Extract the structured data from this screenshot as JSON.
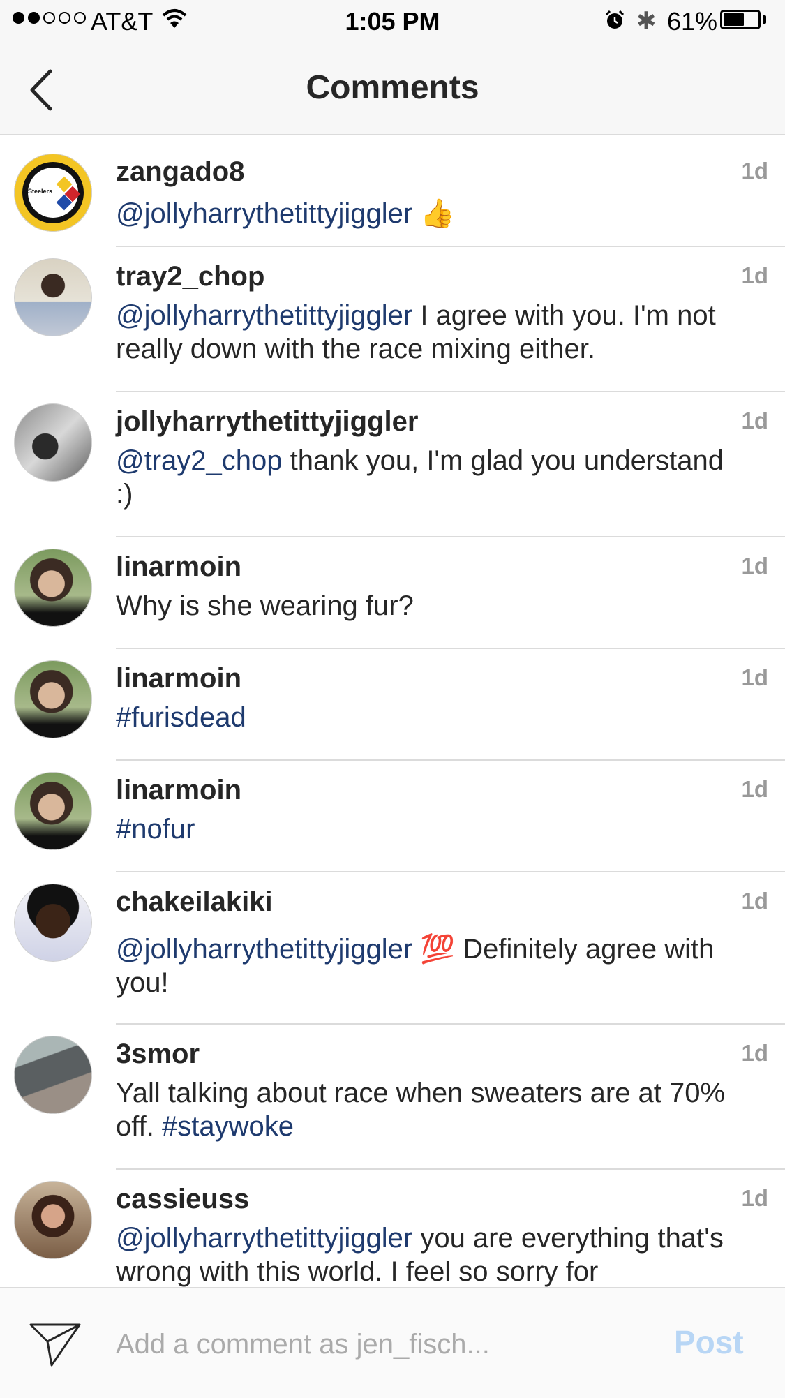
{
  "status_bar": {
    "carrier": "AT&T",
    "time": "1:05 PM",
    "battery": "61%",
    "battery_level": 0.61
  },
  "nav": {
    "title": "Comments",
    "back_icon": "chevron-left-icon"
  },
  "comments": [
    {
      "username": "zangado8",
      "time": "1d",
      "text_parts": [
        {
          "text": "@jollyharrythetittyjiggler",
          "mention": true
        },
        {
          "text": " 👍"
        }
      ]
    },
    {
      "username": "tray2_chop",
      "time": "1d",
      "text_parts": [
        {
          "text": "@jollyharrythetittyjiggler",
          "mention": true
        },
        {
          "text": " I agree with you. I'm not really down with the race mixing either."
        }
      ]
    },
    {
      "username": "jollyharrythetittyjiggler",
      "time": "1d",
      "text_parts": [
        {
          "text": "@tray2_chop",
          "mention": true
        },
        {
          "text": " thank you, I'm glad you understand :)"
        }
      ]
    },
    {
      "username": "linarmoin",
      "time": "1d",
      "text_parts": [
        {
          "text": "Why is she wearing fur?"
        }
      ]
    },
    {
      "username": "linarmoin",
      "time": "1d",
      "text_parts": [
        {
          "text": "#furisdead",
          "mention": true
        }
      ]
    },
    {
      "username": "linarmoin",
      "time": "1d",
      "text_parts": [
        {
          "text": "#nofur",
          "mention": true
        }
      ]
    },
    {
      "username": "chakeilakiki",
      "time": "1d",
      "text_parts": [
        {
          "text": "@jollyharrythetittyjiggler",
          "mention": true
        },
        {
          "text": " 💯  Definitely agree with you!"
        }
      ]
    },
    {
      "username": "3smor",
      "time": "1d",
      "text_parts": [
        {
          "text": "Yall talking about race when sweaters are at 70% off. "
        },
        {
          "text": "#staywoke",
          "mention": true
        }
      ]
    },
    {
      "username": "cassieuss",
      "time": "1d",
      "text_parts": [
        {
          "text": "@jollyharrythetittyjiggler",
          "mention": true
        },
        {
          "text": " you are everything that's wrong with this world. I feel so sorry for"
        }
      ]
    }
  ],
  "avatar_sub_text": "Steelers",
  "input": {
    "placeholder": "Add a comment as jen_fisch...",
    "value": "",
    "post_label": "Post",
    "send_icon": "paper-plane-icon"
  },
  "colors": {
    "mention": "#1e3a6e",
    "post_disabled": "#b8d6f5",
    "timestamp": "#999999"
  }
}
